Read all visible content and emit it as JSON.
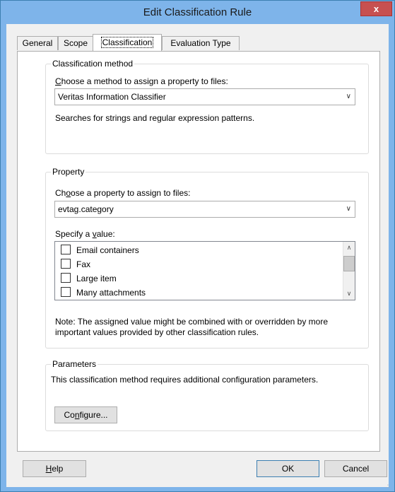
{
  "window": {
    "title": "Edit Classification Rule",
    "close_label": "x"
  },
  "tabs": [
    {
      "label": "General",
      "active": false
    },
    {
      "label": "Scope",
      "active": false
    },
    {
      "label": "Classification",
      "active": true
    },
    {
      "label": "Evaluation Type",
      "active": false
    }
  ],
  "classification_method": {
    "group_label": "Classification method",
    "prompt_prefix": "",
    "prompt_mnemonic": "C",
    "prompt_rest": "hoose a method to assign a property to files:",
    "selected_method": "Veritas Information Classifier",
    "description": "Searches for strings and regular expression patterns."
  },
  "property": {
    "group_label": "Property",
    "prompt_prefix": "Ch",
    "prompt_mnemonic": "o",
    "prompt_rest": "ose a property to assign to files:",
    "selected_property": "evtag.category",
    "value_prompt_prefix": "Specify a ",
    "value_prompt_mnemonic": "v",
    "value_prompt_rest": "alue:",
    "values": [
      {
        "label": "Email containers",
        "checked": false
      },
      {
        "label": "Fax",
        "checked": false
      },
      {
        "label": "Large item",
        "checked": false
      },
      {
        "label": "Many attachments",
        "checked": false
      }
    ],
    "note_line1": "Note: The assigned value might be combined with or overridden by more",
    "note_line2": "important values provided by other classification rules."
  },
  "parameters": {
    "group_label": "Parameters",
    "description": "This classification method requires additional configuration parameters.",
    "configure_prefix": "Co",
    "configure_mnemonic": "n",
    "configure_rest": "figure..."
  },
  "buttons": {
    "help_prefix": "",
    "help_mnemonic": "H",
    "help_rest": "elp",
    "ok_label": "OK",
    "cancel_label": "Cancel"
  },
  "icons": {
    "dropdown": "chevron-down-icon",
    "scroll_up": "scroll-up-icon",
    "scroll_down": "scroll-down-icon"
  }
}
